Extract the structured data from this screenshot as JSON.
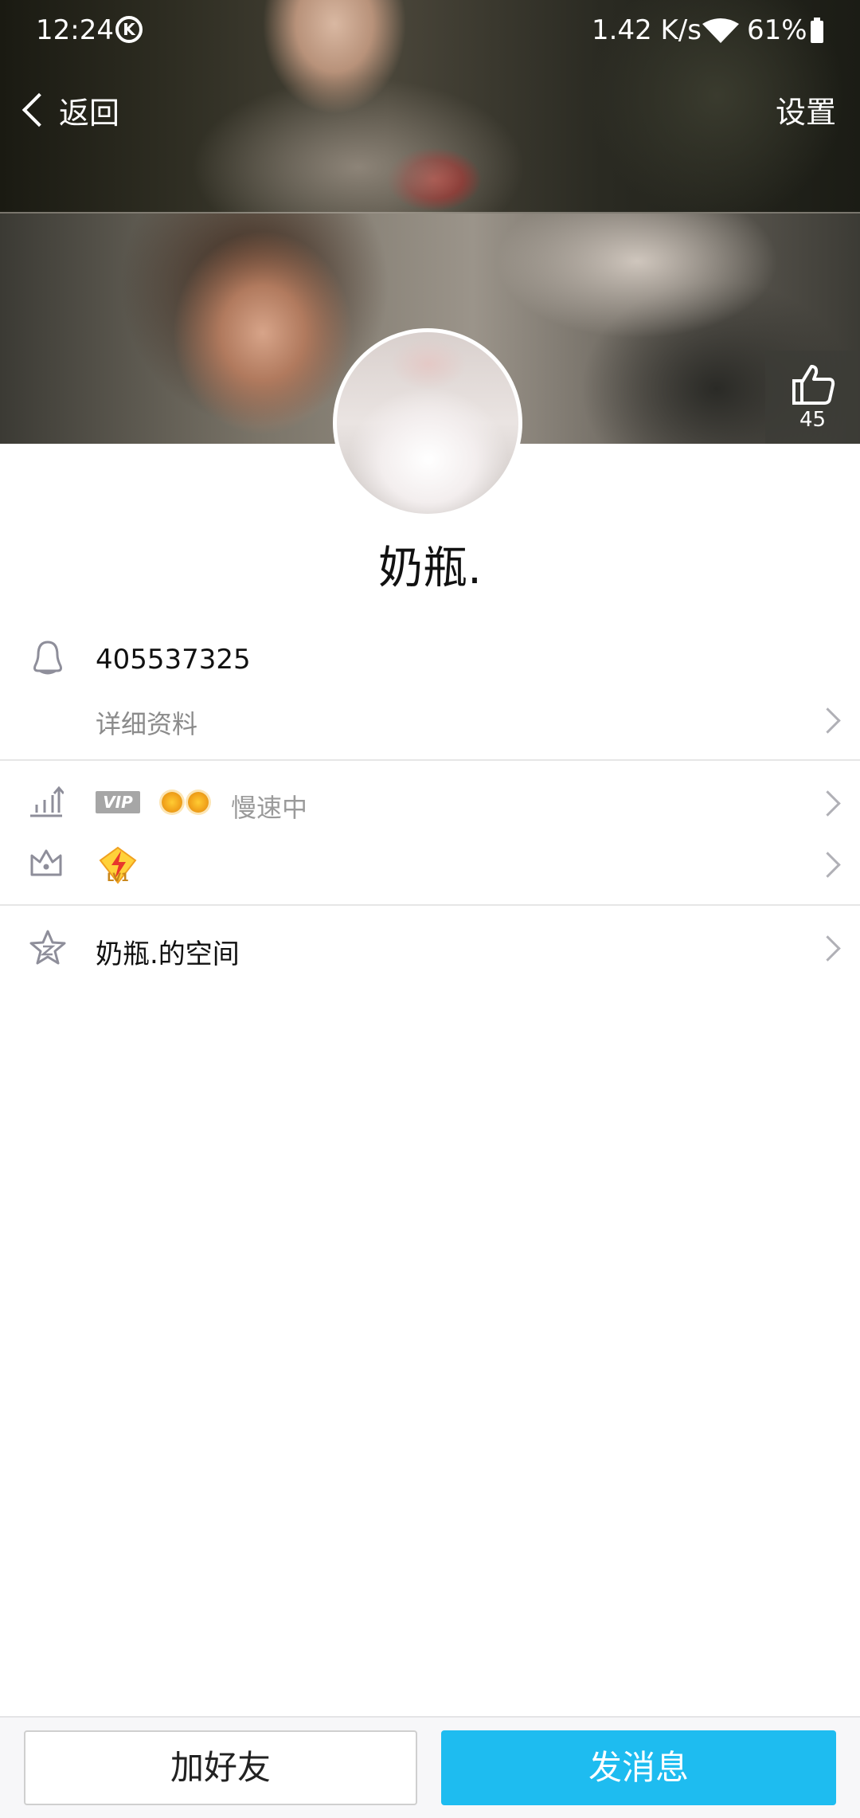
{
  "status_bar": {
    "time": "12:24",
    "k_label": "K",
    "net_speed": "1.42 K/s",
    "battery_percent": "61%"
  },
  "nav": {
    "back_label": "返回",
    "settings_label": "设置"
  },
  "likes": {
    "count": "45"
  },
  "profile": {
    "nickname": "奶瓶.",
    "qq_number": "405537325",
    "details_label": "详细资料",
    "vip_label": "VIP",
    "vip_status": "慢速中",
    "level_badge": "LV1",
    "space_label": "奶瓶.的空间"
  },
  "actions": {
    "add_friend_label": "加好友",
    "send_message_label": "发消息"
  },
  "colors": {
    "accent": "#1ebcf0",
    "divider": "#e6e6e6",
    "muted_text": "#8b8b8b"
  }
}
